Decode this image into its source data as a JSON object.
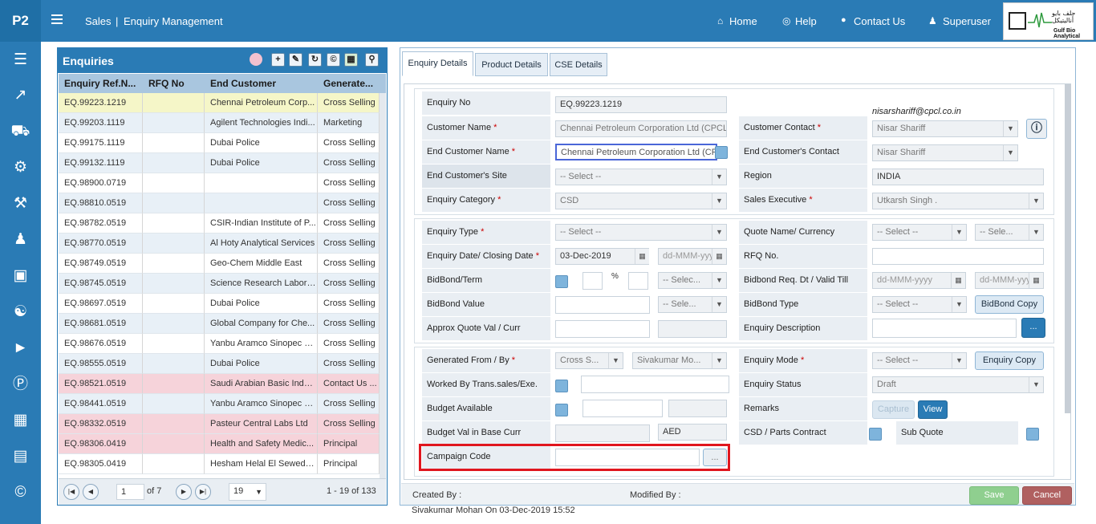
{
  "app": {
    "logo": "P2",
    "breadcrumb_module": "Sales",
    "breadcrumb_sep": "|",
    "breadcrumb_page": "Enquiry Management"
  },
  "topnav": {
    "home": "Home",
    "help": "Help",
    "contact": "Contact Us",
    "user": "Superuser"
  },
  "brand": {
    "arabic": "جلف بايو أناليتيكل",
    "name": "Gulf Bio Analytical"
  },
  "sidebar_icons": [
    "database-icon",
    "chart-icon",
    "truck-icon",
    "gear-icon",
    "wrench-icon",
    "user-icon",
    "money-icon",
    "users-icon",
    "megaphone-icon",
    "parking-icon",
    "cubes-icon",
    "contact-book-icon",
    "copyright-icon"
  ],
  "enquiries": {
    "title": "Enquiries",
    "columns": [
      "Enquiry Ref.N...",
      "RFQ No",
      "End Customer",
      "Generate..."
    ],
    "rows": [
      {
        "ref": "EQ.99223.1219",
        "rfq": "",
        "customer": "Chennai Petroleum Corp...",
        "gen": "Cross Selling",
        "hl": "yellow"
      },
      {
        "ref": "EQ.99203.1119",
        "rfq": "",
        "customer": "Agilent Technologies Indi...",
        "gen": "Marketing",
        "hl": "alt"
      },
      {
        "ref": "EQ.99175.1119",
        "rfq": "",
        "customer": "Dubai Police",
        "gen": "Cross Selling",
        "hl": ""
      },
      {
        "ref": "EQ.99132.1119",
        "rfq": "",
        "customer": "Dubai Police",
        "gen": "Cross Selling",
        "hl": "alt"
      },
      {
        "ref": "EQ.98900.0719",
        "rfq": "",
        "customer": "",
        "gen": "Cross Selling",
        "hl": ""
      },
      {
        "ref": "EQ.98810.0519",
        "rfq": "",
        "customer": "",
        "gen": "Cross Selling",
        "hl": "alt"
      },
      {
        "ref": "EQ.98782.0519",
        "rfq": "",
        "customer": "CSIR-Indian Institute of P...",
        "gen": "Cross Selling",
        "hl": ""
      },
      {
        "ref": "EQ.98770.0519",
        "rfq": "",
        "customer": "Al Hoty Analytical Services",
        "gen": "Cross Selling",
        "hl": "alt"
      },
      {
        "ref": "EQ.98749.0519",
        "rfq": "",
        "customer": "Geo-Chem Middle East",
        "gen": "Cross Selling",
        "hl": ""
      },
      {
        "ref": "EQ.98745.0519",
        "rfq": "",
        "customer": "Science Research Labora...",
        "gen": "Cross Selling",
        "hl": "alt"
      },
      {
        "ref": "EQ.98697.0519",
        "rfq": "",
        "customer": "Dubai Police",
        "gen": "Cross Selling",
        "hl": ""
      },
      {
        "ref": "EQ.98681.0519",
        "rfq": "",
        "customer": "Global Company for Che...",
        "gen": "Cross Selling",
        "hl": "alt"
      },
      {
        "ref": "EQ.98676.0519",
        "rfq": "",
        "customer": "Yanbu Aramco Sinopec R...",
        "gen": "Cross Selling",
        "hl": ""
      },
      {
        "ref": "EQ.98555.0519",
        "rfq": "",
        "customer": "Dubai Police",
        "gen": "Cross Selling",
        "hl": "alt"
      },
      {
        "ref": "EQ.98521.0519",
        "rfq": "",
        "customer": "Saudi Arabian Basic Indus...",
        "gen": "Contact Us ...",
        "hl": "pink"
      },
      {
        "ref": "EQ.98441.0519",
        "rfq": "",
        "customer": "Yanbu Aramco Sinopec R...",
        "gen": "Cross Selling",
        "hl": "alt"
      },
      {
        "ref": "EQ.98332.0519",
        "rfq": "",
        "customer": "Pasteur Central Labs Ltd",
        "gen": "Cross Selling",
        "hl": "pink"
      },
      {
        "ref": "EQ.98306.0419",
        "rfq": "",
        "customer": "Health and Safety Medic...",
        "gen": "Principal",
        "hl": "pink"
      },
      {
        "ref": "EQ.98305.0419",
        "rfq": "",
        "customer": "Hesham Helal El Sewedy ...",
        "gen": "Principal",
        "hl": ""
      }
    ],
    "pager": {
      "page": "1",
      "of": "of 7",
      "page_size": "19",
      "summary": "1 - 19 of 133"
    }
  },
  "tabs": [
    "Enquiry Details",
    "Product Details",
    "CSE Details"
  ],
  "form": {
    "enquiry_no_label": "Enquiry No",
    "enquiry_no": "EQ.99223.1219",
    "email": "nisarshariff@cpcl.co.in",
    "customer_name_label": "Customer Name",
    "customer_name": "Chennai Petroleum Corporation Ltd (CPCL) -",
    "customer_contact_label": "Customer Contact",
    "customer_contact": "Nisar Shariff",
    "end_customer_name_label": "End Customer Name",
    "end_customer_name": "Chennai Petroleum Corporation Ltd (CPCL)",
    "end_customer_contact_label": "End Customer's Contact",
    "end_customer_contact": "Nisar Shariff",
    "end_customer_site_label": "End Customer's Site",
    "end_customer_site": "-- Select --",
    "region_label": "Region",
    "region": "INDIA",
    "enquiry_category_label": "Enquiry Category",
    "enquiry_category": "CSD",
    "sales_exec_label": "Sales Executive",
    "sales_exec": "Utkarsh Singh .",
    "enquiry_type_label": "Enquiry Type",
    "enquiry_type": "-- Select --",
    "quote_name_label": "Quote Name/ Currency",
    "quote_name": "-- Select --",
    "currency": "-- Sele...",
    "enq_date_label": "Enquiry Date/ Closing Date",
    "enq_date": "03-Dec-2019",
    "closing_date": "dd-MMM-yyyy",
    "rfq_label": "RFQ No.",
    "rfq": "",
    "bidbond_term_label": "BidBond/Term",
    "pct": "%",
    "term_unit": "-- Selec...",
    "bidbond_req_label": "Bidbond Req. Dt / Valid Till",
    "bidbond_req": "dd-MMM-yyyy",
    "valid_till": "dd-MMM-yyyy",
    "bidbond_value_label": "BidBond Value",
    "bidbond_value_cur": "-- Sele...",
    "bidbond_type_label": "BidBond Type",
    "bidbond_type": "-- Select --",
    "bidbond_copy": "BidBond Copy",
    "approx_label": "Approx Quote Val / Curr",
    "enq_desc_label": "Enquiry Description",
    "ellipsis": "...",
    "generated_label": "Generated From / By",
    "generated_from": "Cross S...",
    "generated_by": "Sivakumar Mo...",
    "enq_mode_label": "Enquiry Mode",
    "enq_mode": "-- Select --",
    "enq_copy": "Enquiry Copy",
    "worked_label": "Worked By Trans.sales/Exe.",
    "enq_status_label": "Enquiry Status",
    "enq_status": "Draft",
    "budget_label": "Budget Available",
    "remarks_label": "Remarks",
    "capture": "Capture",
    "view": "View",
    "budget_base_label": "Budget Val in Base Curr",
    "base_curr": "AED",
    "csd_label": "CSD / Parts Contract",
    "sub_quote_label": "Sub Quote",
    "campaign_label": "Campaign Code"
  },
  "footer": {
    "created_by": "Created By :",
    "modified_by": "Modified By :",
    "save": "Save",
    "cancel": "Cancel",
    "created_info": "Sivakumar Mohan On 03-Dec-2019 15:52"
  },
  "colors": {
    "brand": "#2a7bb5",
    "highlight_box": "#e0161e",
    "save": "#8fcf8f",
    "cancel": "#b06060"
  }
}
